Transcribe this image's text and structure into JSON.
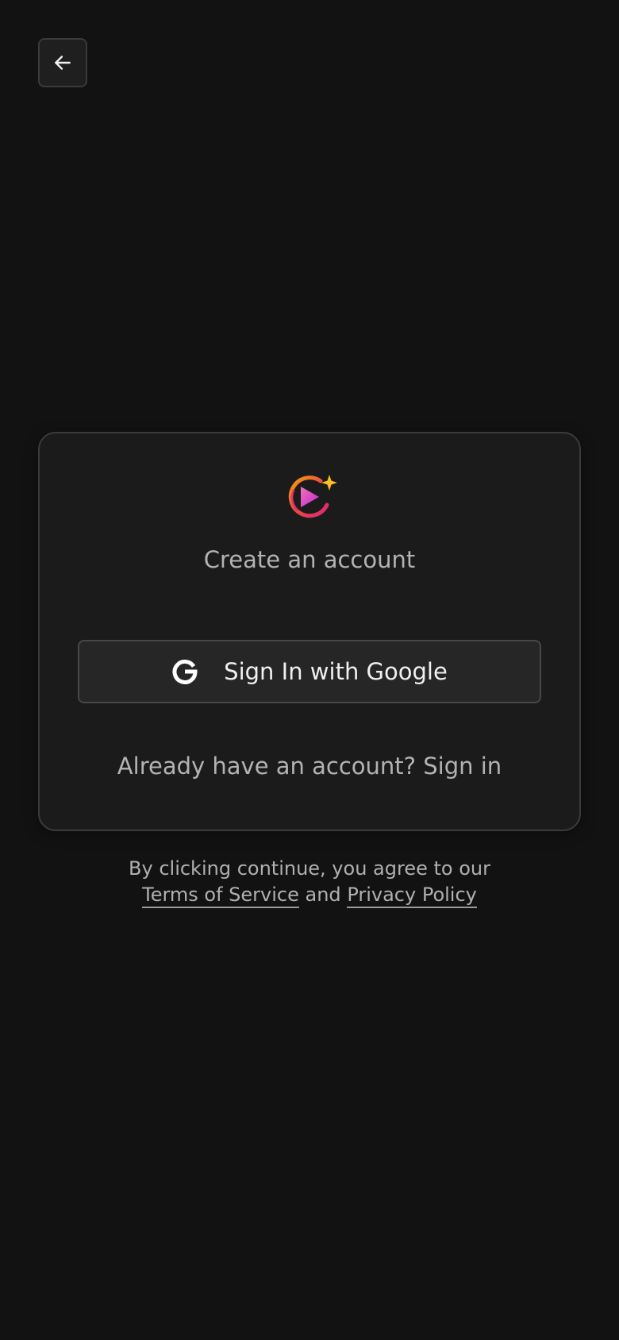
{
  "nav": {
    "back_icon": "arrow-left-icon"
  },
  "card": {
    "logo_icon": "play-sparkle-logo",
    "title": "Create an account",
    "google_button": {
      "icon": "google-icon",
      "label": "Sign In with Google"
    },
    "signin_prompt": "Already have an account? Sign in"
  },
  "legal": {
    "line1": "By clicking continue, you agree to our",
    "terms_label": "Terms of Service",
    "conjunction": "and",
    "privacy_label": "Privacy Policy"
  },
  "colors": {
    "background": "#121212",
    "card": "#1b1b1b",
    "logo_gradient_start": "#f59e0b",
    "logo_gradient_end": "#db2777",
    "sparkle": "#fbbf24"
  }
}
